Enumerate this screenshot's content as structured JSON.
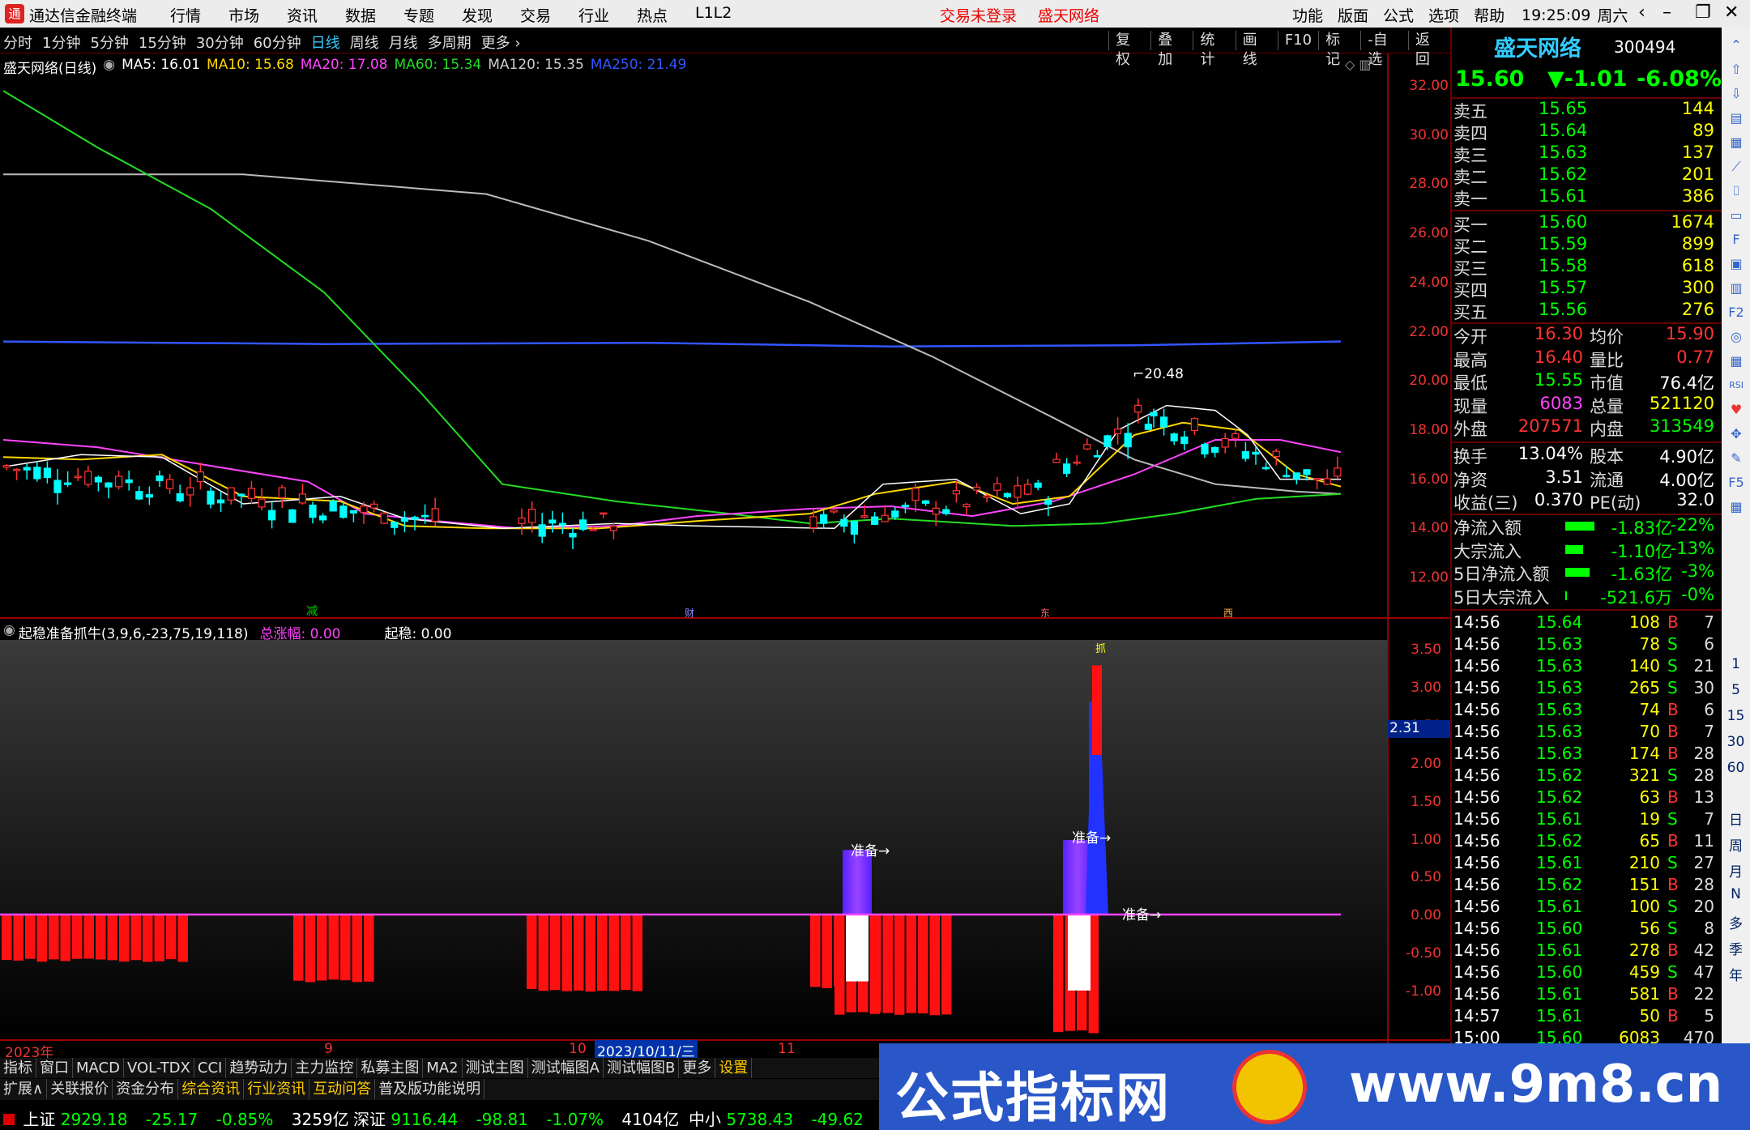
{
  "titlebar": {
    "app_name": "通达信金融终端",
    "menu": [
      "行情",
      "市场",
      "资讯",
      "数据",
      "专题",
      "发现",
      "交易",
      "行业",
      "热点",
      "L1L2"
    ],
    "status_not_logged": "交易未登录",
    "status_source": "盛天网络",
    "right_menu": [
      "功能",
      "版面",
      "公式",
      "选项",
      "帮助"
    ],
    "time": "19:25:09",
    "weekday": "周六"
  },
  "toolbar": {
    "periods": [
      "分时",
      "1分钟",
      "5分钟",
      "15分钟",
      "30分钟",
      "60分钟",
      "日线",
      "周线",
      "月线",
      "多周期",
      "更多"
    ],
    "active_period": "日线",
    "tools": [
      "复权",
      "叠加",
      "统计",
      "画线",
      "F10",
      "标记",
      "-自选",
      "返回"
    ]
  },
  "main_chart": {
    "title": "盛天网络(日线)",
    "ma": [
      {
        "label": "MA5: 16.01",
        "color": "#ffffff"
      },
      {
        "label": "MA10: 15.68",
        "color": "#ffd700"
      },
      {
        "label": "MA20: 17.08",
        "color": "#ff44ff"
      },
      {
        "label": "MA60: 15.34",
        "color": "#22dd22"
      },
      {
        "label": "MA120: 15.35",
        "color": "#cccccc"
      },
      {
        "label": "MA250: 21.49",
        "color": "#3355ff"
      }
    ],
    "high_marker": "20.48",
    "y_ticks": [
      "32.00",
      "30.00",
      "28.00",
      "26.00",
      "24.00",
      "22.00",
      "20.00",
      "18.00",
      "16.00",
      "14.00",
      "12.00"
    ],
    "bottom_markers": [
      "减",
      "财",
      "东",
      "西"
    ]
  },
  "sub_chart": {
    "title": "起稳准备抓牛(3,9,6,-23,75,19,118)",
    "total_label": "总涨幅: 0.00",
    "stable_label": "起稳: 0.00",
    "y_ticks": [
      "3.50",
      "3.00",
      "2.50",
      "2.00",
      "1.50",
      "1.00",
      "0.50",
      "0.00",
      "-0.50",
      "-1.00"
    ],
    "cursor_value": "2.31",
    "annotations": [
      "准备→",
      "准备→",
      "准备→",
      "抓"
    ]
  },
  "x_axis": {
    "labels": [
      "2023年",
      "9",
      "10",
      "2023/10/11/三",
      "11"
    ]
  },
  "tabs_row1": [
    "指标",
    "窗口",
    "MACD",
    "VOL-TDX",
    "CCI",
    "趋势动力",
    "主力监控",
    "私募主图",
    "MA2",
    "测试主图",
    "测试幅图A",
    "测试幅图B",
    "更多",
    "设置"
  ],
  "tabs_row2": [
    "扩展∧",
    "关联报价",
    "资金分布",
    "综合资讯",
    "行业资讯",
    "互动问答",
    "普及版功能说明"
  ],
  "index_bar": [
    {
      "name": "上证",
      "value": "2929.18",
      "chg": "-25.17",
      "pct": "-0.85%",
      "amt": "3259亿"
    },
    {
      "name": "深证",
      "value": "9116.44",
      "chg": "-98.81",
      "pct": "-1.07%",
      "amt": "4104亿"
    },
    {
      "name": "中小",
      "value": "5738.43",
      "chg": "-49.62",
      "pct": "",
      "amt": ""
    }
  ],
  "quote": {
    "name": "盛天网络",
    "code": "300494",
    "price": "15.60",
    "change": "▼-1.01",
    "pct": "-6.08%",
    "asks": [
      {
        "label": "卖五",
        "price": "15.65",
        "vol": "144"
      },
      {
        "label": "卖四",
        "price": "15.64",
        "vol": "89"
      },
      {
        "label": "卖三",
        "price": "15.63",
        "vol": "137"
      },
      {
        "label": "卖二",
        "price": "15.62",
        "vol": "201"
      },
      {
        "label": "卖一",
        "price": "15.61",
        "vol": "386"
      }
    ],
    "bids": [
      {
        "label": "买一",
        "price": "15.60",
        "vol": "1674"
      },
      {
        "label": "买二",
        "price": "15.59",
        "vol": "899"
      },
      {
        "label": "买三",
        "price": "15.58",
        "vol": "618"
      },
      {
        "label": "买四",
        "price": "15.57",
        "vol": "300"
      },
      {
        "label": "买五",
        "price": "15.56",
        "vol": "276"
      }
    ],
    "stats": [
      {
        "k1": "今开",
        "v1": "16.30",
        "c1": "#ff3333",
        "k2": "均价",
        "v2": "15.90",
        "c2": "#ff3333"
      },
      {
        "k1": "最高",
        "v1": "16.40",
        "c1": "#ff3333",
        "k2": "量比",
        "v2": "0.77",
        "c2": "#ff3333"
      },
      {
        "k1": "最低",
        "v1": "15.55",
        "c1": "#00ff00",
        "k2": "市值",
        "v2": "76.4亿",
        "c2": "#ffffff"
      },
      {
        "k1": "现量",
        "v1": "6083",
        "c1": "#ff44ff",
        "k2": "总量",
        "v2": "521120",
        "c2": "#ffff00"
      },
      {
        "k1": "外盘",
        "v1": "207571",
        "c1": "#ff3333",
        "k2": "内盘",
        "v2": "313549",
        "c2": "#00ff00"
      }
    ],
    "stats2": [
      {
        "k1": "换手",
        "v1": "13.04%",
        "k2": "股本",
        "v2": "4.90亿"
      },
      {
        "k1": "净资",
        "v1": "3.51",
        "k2": "流通",
        "v2": "4.00亿"
      },
      {
        "k1": "收益(三)",
        "v1": "0.370",
        "k2": "PE(动)",
        "v2": "32.0"
      }
    ],
    "flows": [
      {
        "label": "净流入额",
        "value": "-1.83亿",
        "pct": "-22%",
        "bar": 36
      },
      {
        "label": "大宗流入",
        "value": "-1.10亿",
        "pct": "-13%",
        "bar": 22
      },
      {
        "label": "5日净流入额",
        "value": "-1.63亿",
        "pct": "-3%",
        "bar": 30
      },
      {
        "label": "5日大宗流入",
        "value": "-521.6万",
        "pct": "-0%",
        "bar": 2
      }
    ],
    "ticks": [
      {
        "t": "14:56",
        "p": "15.64",
        "v": "108",
        "bs": "B",
        "n": "7"
      },
      {
        "t": "14:56",
        "p": "15.63",
        "v": "78",
        "bs": "S",
        "n": "6"
      },
      {
        "t": "14:56",
        "p": "15.63",
        "v": "140",
        "bs": "S",
        "n": "21"
      },
      {
        "t": "14:56",
        "p": "15.63",
        "v": "265",
        "bs": "S",
        "n": "30"
      },
      {
        "t": "14:56",
        "p": "15.63",
        "v": "74",
        "bs": "B",
        "n": "6"
      },
      {
        "t": "14:56",
        "p": "15.63",
        "v": "70",
        "bs": "B",
        "n": "7"
      },
      {
        "t": "14:56",
        "p": "15.63",
        "v": "174",
        "bs": "B",
        "n": "28"
      },
      {
        "t": "14:56",
        "p": "15.62",
        "v": "321",
        "bs": "S",
        "n": "28"
      },
      {
        "t": "14:56",
        "p": "15.62",
        "v": "63",
        "bs": "B",
        "n": "13"
      },
      {
        "t": "14:56",
        "p": "15.61",
        "v": "19",
        "bs": "S",
        "n": "7"
      },
      {
        "t": "14:56",
        "p": "15.62",
        "v": "65",
        "bs": "B",
        "n": "11"
      },
      {
        "t": "14:56",
        "p": "15.61",
        "v": "210",
        "bs": "S",
        "n": "27"
      },
      {
        "t": "14:56",
        "p": "15.62",
        "v": "151",
        "bs": "B",
        "n": "28"
      },
      {
        "t": "14:56",
        "p": "15.61",
        "v": "100",
        "bs": "S",
        "n": "20"
      },
      {
        "t": "14:56",
        "p": "15.60",
        "v": "56",
        "bs": "S",
        "n": "8"
      },
      {
        "t": "14:56",
        "p": "15.61",
        "v": "278",
        "bs": "B",
        "n": "42"
      },
      {
        "t": "14:56",
        "p": "15.60",
        "v": "459",
        "bs": "S",
        "n": "47"
      },
      {
        "t": "14:56",
        "p": "15.61",
        "v": "581",
        "bs": "B",
        "n": "22"
      },
      {
        "t": "14:57",
        "p": "15.61",
        "v": "50",
        "bs": "B",
        "n": "5"
      },
      {
        "t": "15:00",
        "p": "15.60",
        "v": "6083",
        "bs": "",
        "n": "470"
      }
    ]
  },
  "icon_strip": {
    "icons": [
      "up-arrow-icon",
      "up-icon",
      "down-icon",
      "list-icon",
      "grid-icon",
      "chart-icon",
      "candle-icon",
      "doc-icon",
      "fin-icon",
      "page-icon",
      "news-icon",
      "f2-icon",
      "circle-icon",
      "grid2-icon",
      "rsi-icon",
      "heart-icon",
      "move-icon",
      "pen-icon",
      "f5-icon",
      "table-icon"
    ],
    "numbers": [
      "1",
      "5",
      "15",
      "30",
      "60"
    ],
    "periods": [
      "日",
      "周",
      "月",
      "N",
      "多",
      "季",
      "年"
    ]
  },
  "watermark": {
    "text_cn": "公式指标网",
    "url": "www.9m8.cn"
  },
  "colors": {
    "up": "#ff3333",
    "down": "#00ffff",
    "green": "#00ff00",
    "yellow": "#ffff00",
    "border": "#660000",
    "accent_blue": "#33ccff"
  }
}
